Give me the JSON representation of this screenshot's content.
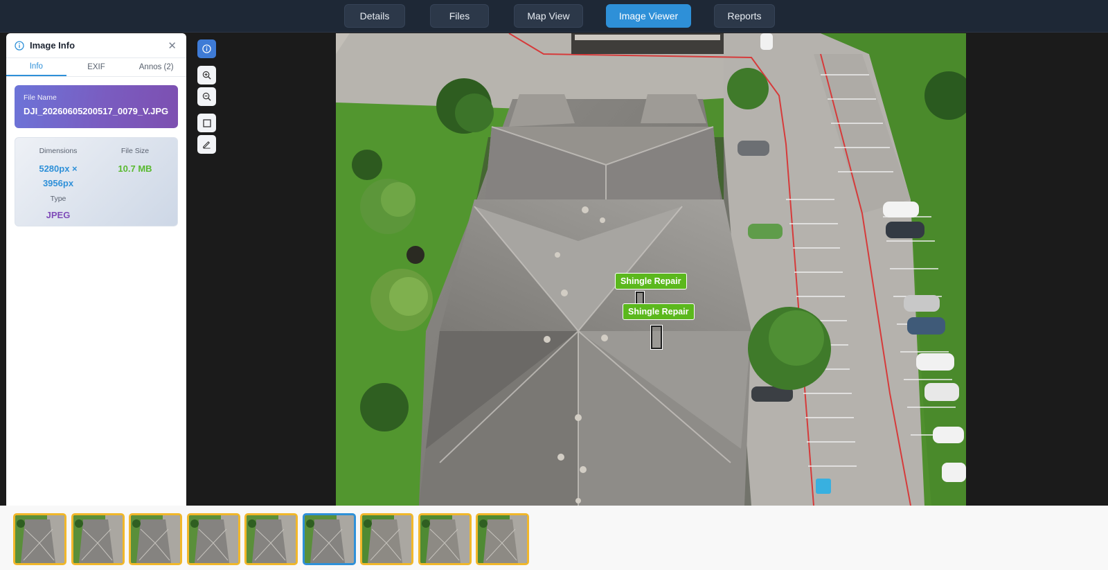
{
  "nav": {
    "tabs": [
      {
        "label": "Details"
      },
      {
        "label": "Files"
      },
      {
        "label": "Map View"
      },
      {
        "label": "Image Viewer",
        "active": true
      },
      {
        "label": "Reports"
      }
    ]
  },
  "info_panel": {
    "title": "Image Info",
    "tabs": [
      "Info",
      "EXIF",
      "Annos (2)"
    ],
    "active_tab": "Info",
    "file_name_label": "File Name",
    "file_name": "DJI_20260605200517_0079_V.JPG",
    "dimensions_label": "Dimensions",
    "dimensions_line1": "5280px ×",
    "dimensions_line2": "3956px",
    "file_size_label": "File Size",
    "file_size": "10.7 MB",
    "type_label": "Type",
    "type": "JPEG"
  },
  "tools": [
    "info-icon",
    "zoom-in-icon",
    "zoom-out-icon",
    "rectangle-icon",
    "pencil-icon"
  ],
  "annotations": [
    {
      "label": "Shingle Repair"
    },
    {
      "label": "Shingle Repair"
    }
  ],
  "thumbnails": {
    "count": 9,
    "selected_index": 5
  },
  "colors": {
    "accent": "#2e90d8",
    "annotation": "#5bb81d",
    "thumbnail_border": "#f1b72a",
    "dimensions_text": "#2e90d8",
    "file_size_text": "#59b92f",
    "type_text": "#7f4bb8"
  }
}
